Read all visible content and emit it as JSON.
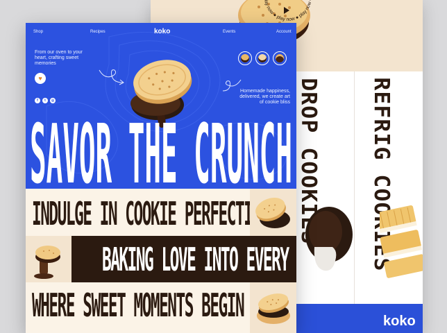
{
  "back_page": {
    "circular_text": "play now ● play now ● play now ●",
    "vertical_labels": [
      "DROP COOKIES",
      "REFRIG COOKIES"
    ],
    "footer_logo": "koko"
  },
  "front_page": {
    "nav": {
      "left_items": [
        "Shop",
        "Recipes"
      ],
      "logo": "koko",
      "right_items": [
        "Events",
        "Account"
      ]
    },
    "tagline": "From our oven to your heart, crafting sweet memories",
    "right_text": "Homemade happiness, delivered, we create art of cookie bliss",
    "social_icons": [
      "facebook-icon",
      "twitter-icon",
      "instagram-icon"
    ],
    "hero_title": "SAVOR THE CRUNCH",
    "rows": [
      "INDULGE IN COOKIE PERFECTION",
      "BAKING LOVE INTO EVERY BITE",
      "WHERE SWEET MOMENTS BEGIN"
    ]
  },
  "colors": {
    "brand_blue": "#2c52e0",
    "chocolate": "#2b1a10",
    "cream": "#fbf3e7",
    "beige": "#f3e4cf",
    "biscuit": "#e9b868"
  }
}
